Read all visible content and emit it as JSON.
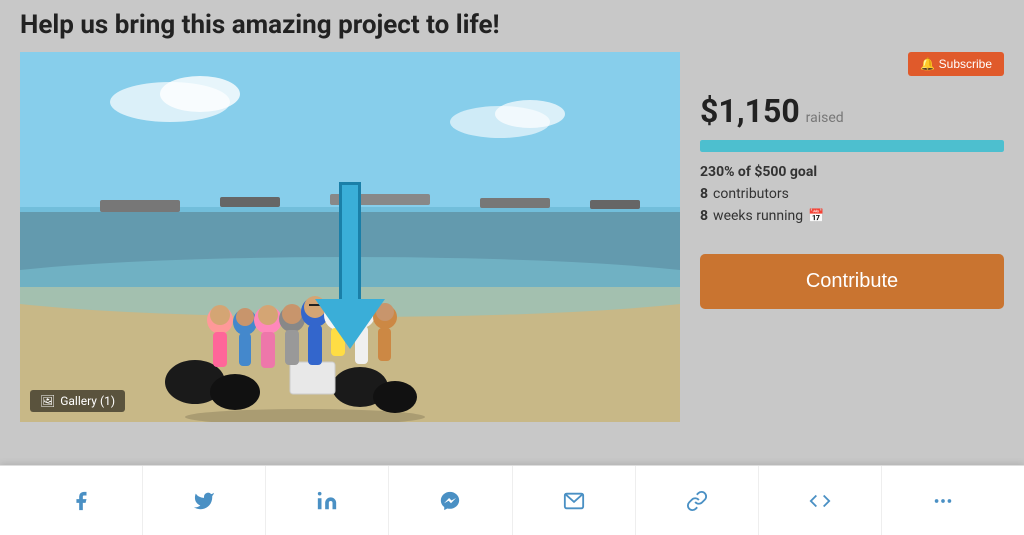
{
  "page": {
    "title": "Help us bring this amazing project to life!"
  },
  "subscribe_button": {
    "label": "🔔 Subscribe"
  },
  "stats": {
    "amount": "$1,150",
    "raised_label": "raised",
    "progress_percent": 100,
    "goal_text": "230% of $500 goal",
    "contributors": "8",
    "contributors_label": "contributors",
    "weeks_running": "8",
    "weeks_label": "weeks running"
  },
  "contribute_button": {
    "label": "Contribute"
  },
  "gallery": {
    "label": "Gallery (1)"
  },
  "share_bar": {
    "icons": [
      {
        "name": "facebook-icon",
        "symbol": "f",
        "unicode": "𝐟",
        "label": "Facebook"
      },
      {
        "name": "twitter-icon",
        "symbol": "t",
        "label": "Twitter"
      },
      {
        "name": "linkedin-icon",
        "symbol": "in",
        "label": "LinkedIn"
      },
      {
        "name": "messenger-icon",
        "symbol": "m",
        "label": "Messenger"
      },
      {
        "name": "email-icon",
        "symbol": "✉",
        "label": "Email"
      },
      {
        "name": "link-icon",
        "symbol": "🔗",
        "label": "Copy Link"
      },
      {
        "name": "embed-icon",
        "symbol": "</>",
        "label": "Embed"
      },
      {
        "name": "more-icon",
        "symbol": "•••",
        "label": "More"
      }
    ]
  }
}
